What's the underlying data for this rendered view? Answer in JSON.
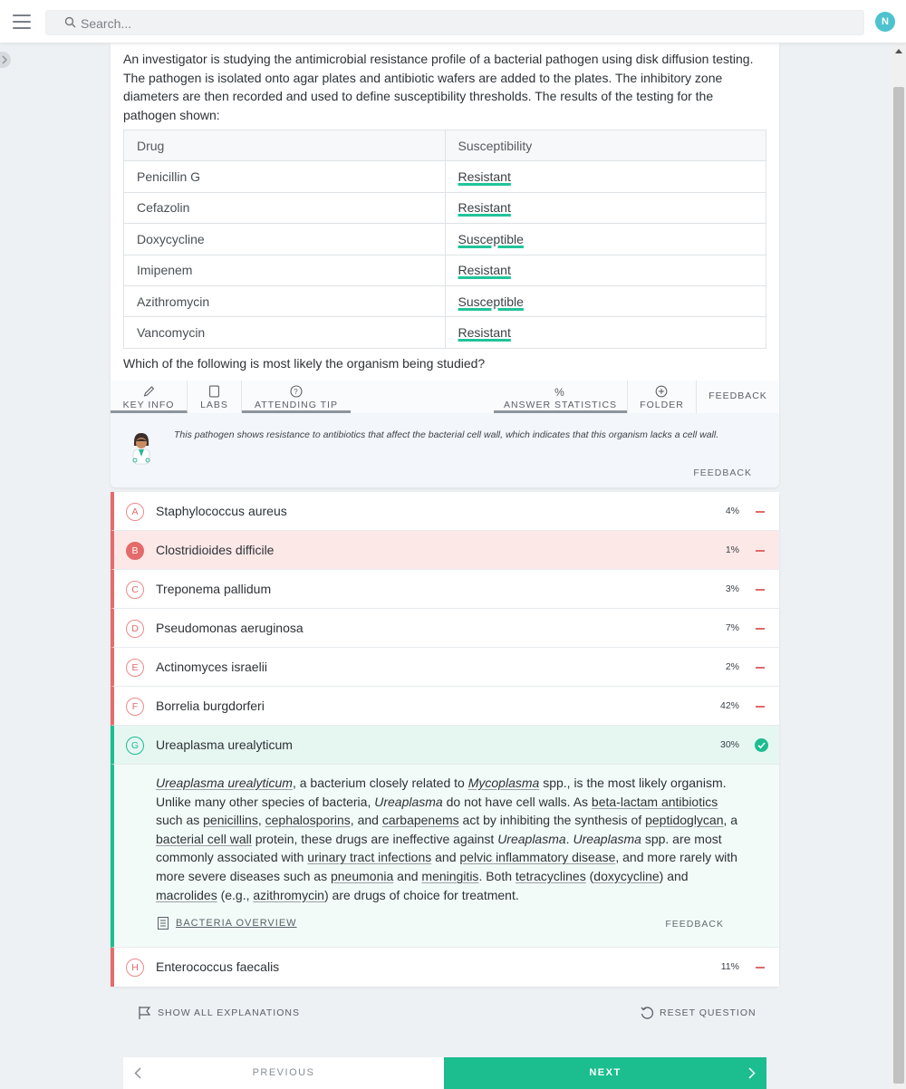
{
  "search": {
    "placeholder": "Search..."
  },
  "user": {
    "initial": "N"
  },
  "question": {
    "stem": "An investigator is studying the antimicrobial resistance profile of a bacterial pathogen using disk diffusion testing. The pathogen is isolated onto agar plates and antibiotic wafers are added to the plates. The inhibitory zone diameters are then recorded and used to define susceptibility thresholds. The results of the testing for the pathogen shown:",
    "table": {
      "headers": [
        "Drug",
        "Susceptibility"
      ],
      "rows": [
        [
          "Penicillin G",
          "Resistant"
        ],
        [
          "Cefazolin",
          "Resistant"
        ],
        [
          "Doxycycline",
          "Susceptible"
        ],
        [
          "Imipenem",
          "Resistant"
        ],
        [
          "Azithromycin",
          "Susceptible"
        ],
        [
          "Vancomycin",
          "Resistant"
        ]
      ]
    },
    "prompt": "Which of the following is most likely the organism being studied?"
  },
  "tabs": {
    "key_info": "KEY INFO",
    "labs": "LABS",
    "attending_tip": "ATTENDING TIP",
    "answer_statistics": "ANSWER STATISTICS",
    "folder": "FOLDER",
    "feedback": "FEEDBACK"
  },
  "attending_tip": {
    "text": "This pathogen shows resistance to antibiotics that affect the bacterial cell wall, which indicates that this organism lacks a cell wall.",
    "feedback": "FEEDBACK"
  },
  "answers": [
    {
      "letter": "A",
      "text": "Staphylococcus aureus",
      "pct": "4%"
    },
    {
      "letter": "B",
      "text": "Clostridioides difficile",
      "pct": "1%"
    },
    {
      "letter": "C",
      "text": "Treponema pallidum",
      "pct": "3%"
    },
    {
      "letter": "D",
      "text": "Pseudomonas aeruginosa",
      "pct": "7%"
    },
    {
      "letter": "E",
      "text": "Actinomyces israelii",
      "pct": "2%"
    },
    {
      "letter": "F",
      "text": "Borrelia burgdorferi",
      "pct": "42%"
    },
    {
      "letter": "G",
      "text": "Ureaplasma urealyticum",
      "pct": "30%"
    },
    {
      "letter": "H",
      "text": "Enterococcus faecalis",
      "pct": "11%"
    }
  ],
  "explanation": {
    "parts": {
      "p1": "Ureaplasma urealyticum",
      "p2": ", a bacterium closely related to ",
      "p3": "Mycoplasma",
      "p4": " spp., is the most likely organism. Unlike many other species of bacteria, ",
      "p5": "Ureaplasma",
      "p6": " do not have cell walls. As ",
      "p7": "beta-lactam antibiotics",
      "p8": " such as ",
      "p9": "penicillins",
      "p10": ", ",
      "p11": "cephalosporins",
      "p12": ", and ",
      "p13": "carbapenems",
      "p14": " act by inhibiting the synthesis of ",
      "p15": "peptidoglycan",
      "p16": ", a ",
      "p17": "bacterial cell wall",
      "p18": " protein, these drugs are ineffective against ",
      "p19": "Ureaplasma",
      "p20": ". ",
      "p21": "Ureaplasma",
      "p22": " spp. are most commonly associated with ",
      "p23": "urinary tract infections",
      "p24": " and ",
      "p25": "pelvic inflammatory disease",
      "p26": ", and more rarely with more severe diseases such as ",
      "p27": "pneumonia",
      "p28": " and ",
      "p29": "meningitis",
      "p30": ". Both ",
      "p31": "tetracyclines",
      "p32": " (",
      "p33": "doxycycline",
      "p34": ") and ",
      "p35": "macrolides",
      "p36": " (e.g., ",
      "p37": "azithromycin",
      "p38": ") are drugs of choice for treatment."
    },
    "link": "BACTERIA OVERVIEW",
    "feedback": "FEEDBACK"
  },
  "controls": {
    "show_all": "SHOW ALL EXPLANATIONS",
    "reset": "RESET QUESTION",
    "previous": "PREVIOUS",
    "next": "NEXT"
  },
  "colors": {
    "accent": "#1cbd8f",
    "wrong": "#e66b6b",
    "avatar": "#4ec3cf"
  }
}
